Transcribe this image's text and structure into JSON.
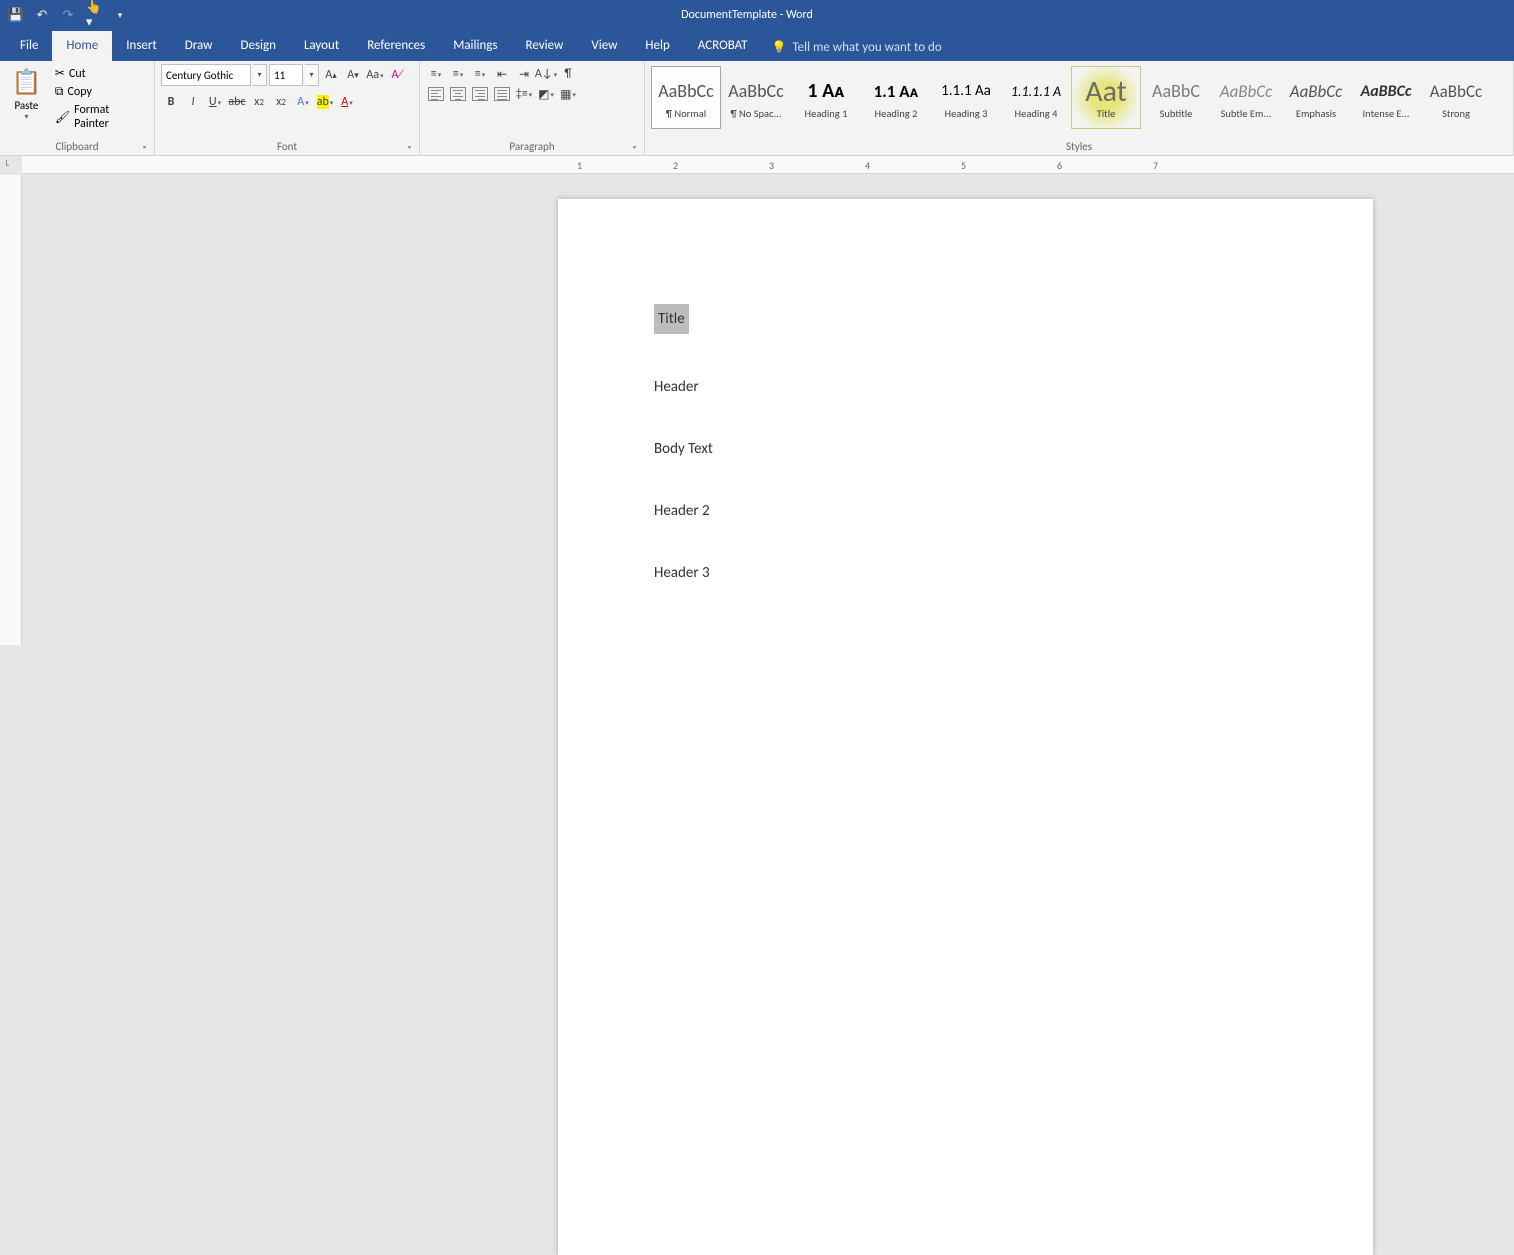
{
  "titlebar_title": "DocumentTemplate - Word",
  "tabs": [
    "File",
    "Home",
    "Insert",
    "Draw",
    "Design",
    "Layout",
    "References",
    "Mailings",
    "Review",
    "View",
    "Help",
    "ACROBAT"
  ],
  "tellme_placeholder": "Tell me what you want to do",
  "clipboard": {
    "paste": "Paste",
    "cut": "Cut",
    "copy": "Copy",
    "format_painter": "Format Painter",
    "label": "Clipboard"
  },
  "font": {
    "name": "Century Gothic",
    "size": "11",
    "label": "Font"
  },
  "paragraph": {
    "label": "Paragraph"
  },
  "styles": {
    "label": "Styles",
    "items": [
      {
        "preview": "AaBbCc",
        "name": "¶ Normal",
        "cls": ""
      },
      {
        "preview": "AaBbCc",
        "name": "¶ No Spac...",
        "cls": ""
      },
      {
        "preview": "1  Aᴀ",
        "name": "Heading 1",
        "cls": "h1"
      },
      {
        "preview": "1.1  Aᴀ",
        "name": "Heading 2",
        "cls": "h2"
      },
      {
        "preview": "1.1.1  Aa",
        "name": "Heading 3",
        "cls": "h3"
      },
      {
        "preview": "1.1.1.1  A",
        "name": "Heading 4",
        "cls": "h4"
      },
      {
        "preview": "Aat",
        "name": "Title",
        "cls": "title"
      },
      {
        "preview": "AaBbC",
        "name": "Subtitle",
        "cls": ""
      },
      {
        "preview": "AaBbCc",
        "name": "Subtle Em...",
        "cls": "subtleem"
      },
      {
        "preview": "AaBbCc",
        "name": "Emphasis",
        "cls": "em"
      },
      {
        "preview": "AaBBCc",
        "name": "Intense E...",
        "cls": "intense"
      },
      {
        "preview": "AaBbCc",
        "name": "Strong",
        "cls": "strong"
      }
    ]
  },
  "ruler_numbers": [
    "1",
    "2",
    "3",
    "4",
    "5",
    "6",
    "7"
  ],
  "document": {
    "title": "Title",
    "lines": [
      "Header",
      "Body Text",
      "Header 2",
      "Header 3"
    ]
  }
}
